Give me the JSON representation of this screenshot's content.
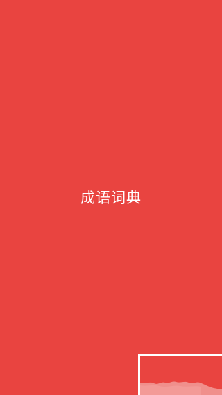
{
  "app": {
    "title": "成语词典"
  },
  "colors": {
    "background": "#e94440",
    "title_text": "#ffffff",
    "badge_border": "#ffffff",
    "badge_wave": "#f08f8c"
  },
  "corner_badge": {
    "icon": "wave-logo-icon"
  }
}
